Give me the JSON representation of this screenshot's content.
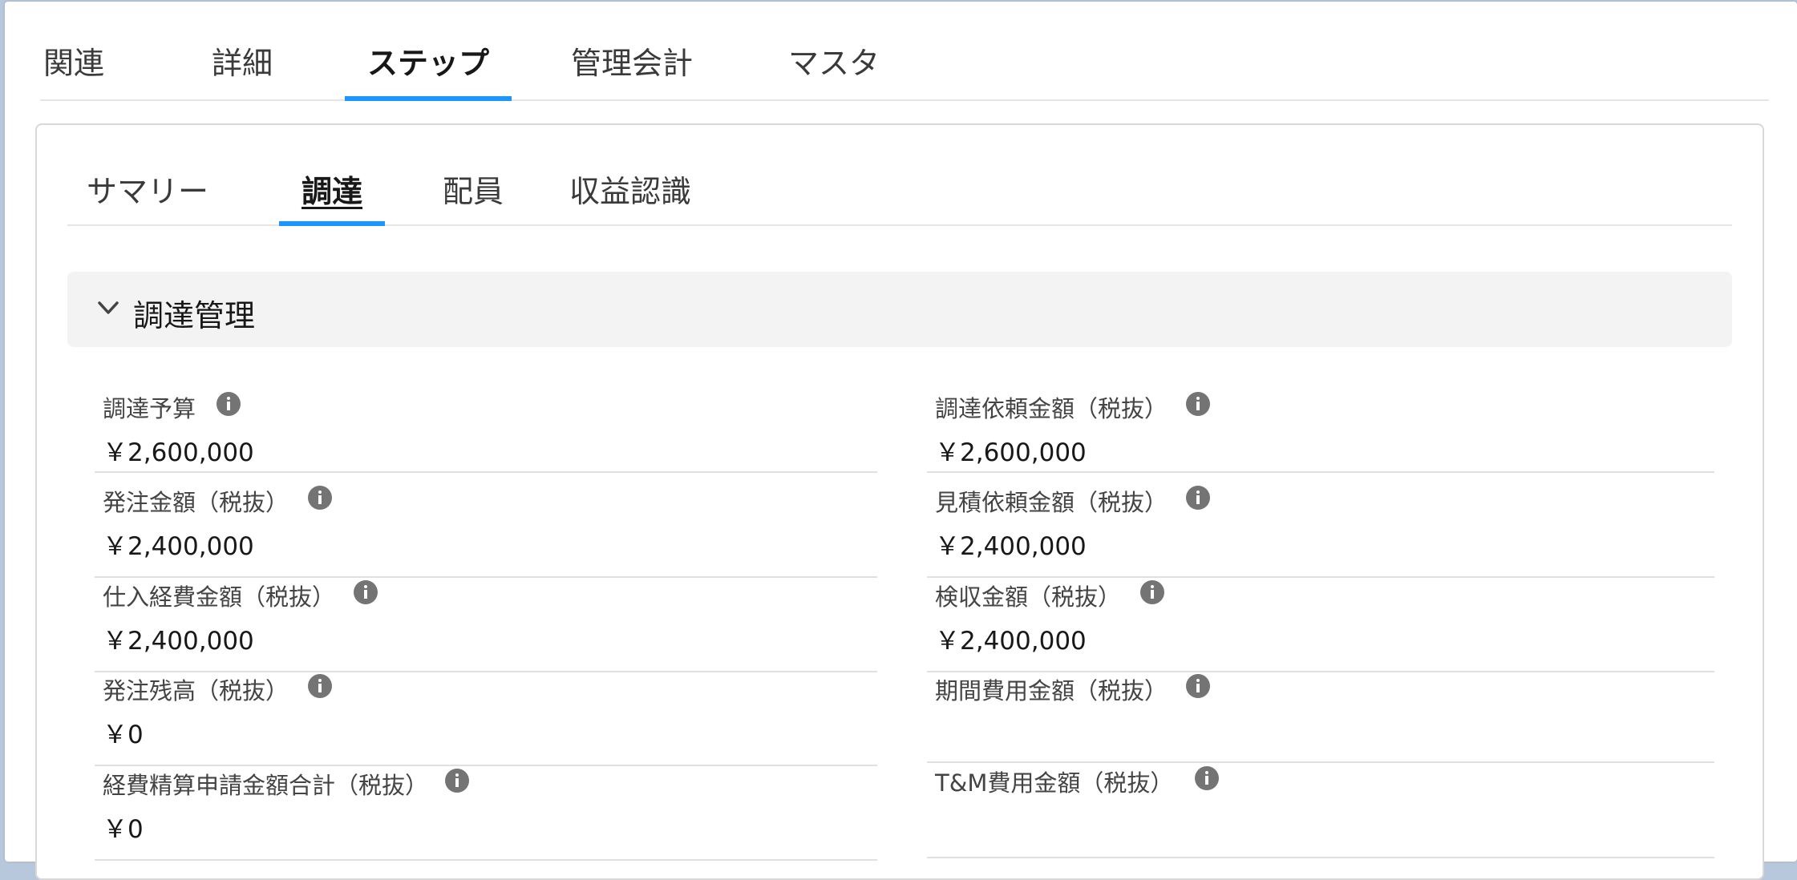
{
  "top_tabs": [
    "関連",
    "詳細",
    "ステップ",
    "管理会計",
    "マスタ"
  ],
  "sub_tabs": [
    "サマリー",
    "調達",
    "配員",
    "収益認識"
  ],
  "section": {
    "title": "調達管理"
  },
  "fields_left": [
    {
      "label": "調達予算",
      "value": "￥2,600,000"
    },
    {
      "label": "発注金額（税抜）",
      "value": "￥2,400,000"
    },
    {
      "label": "仕入経費金額（税抜）",
      "value": "￥2,400,000"
    },
    {
      "label": "発注残高（税抜）",
      "value": "￥0"
    },
    {
      "label": "経費精算申請金額合計（税抜）",
      "value": "￥0"
    }
  ],
  "fields_right": [
    {
      "label": "調達依頼金額（税抜）",
      "value": "￥2,600,000"
    },
    {
      "label": "見積依頼金額（税抜）",
      "value": "￥2,400,000"
    },
    {
      "label": "検収金額（税抜）",
      "value": "￥2,400,000"
    },
    {
      "label": "期間費用金額（税抜）",
      "value": ""
    },
    {
      "label": "T&M費用金額（税抜）",
      "value": ""
    }
  ],
  "colors": {
    "accent": "#1b96ff",
    "info_icon": "#747474",
    "section_bg": "#f3f3f3"
  },
  "icons": {
    "section_toggle": "chevron-down-icon",
    "help": "info-icon"
  }
}
